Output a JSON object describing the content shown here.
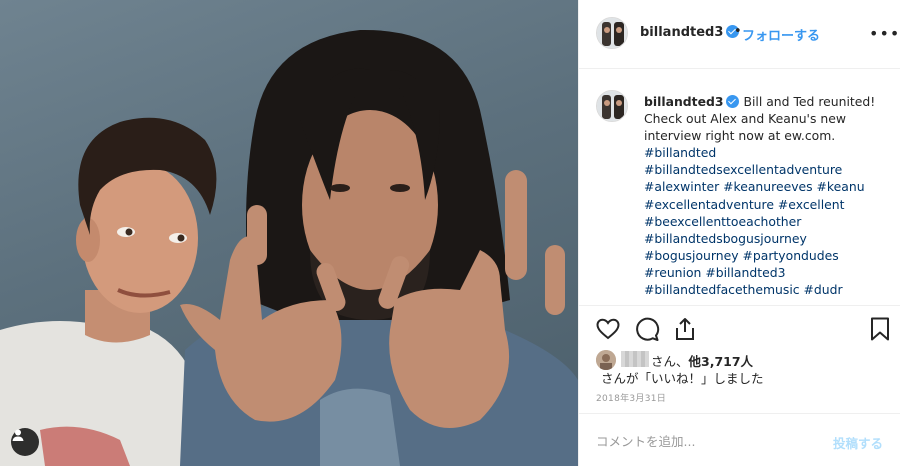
{
  "post": {
    "username": "billandted3",
    "dot": "•",
    "follow_label": "フォローする",
    "more_icon": "more-horizontal-icon",
    "caption_text": "Bill and Ted reunited! Check out Alex and Keanu's new interview right now at ew.com.",
    "hashtags": [
      "#billandted",
      "#billandtedsexcellentadventure",
      "#alexwinter #keanureeves #keanu",
      "#excellentadventure #excellent",
      "#beexcellenttoeachother",
      "#billandtedsbogusjourney",
      "#bogusjourney #partyondudes",
      "#reunion #billandted3",
      "#billandtedfacethemusic #dudr"
    ],
    "likes_line1_suffix": "さん、",
    "likes_count": "他3,717人",
    "likes_line2": "さんが「いいね！」しました",
    "date": "2018年3月31日",
    "comment_placeholder": "コメントを追加...",
    "post_button": "投稿する"
  },
  "colors": {
    "link_blue": "#3897f0",
    "hashtag": "#003569",
    "border": "#efefef",
    "muted": "#999999",
    "post_disabled": "#b2dffc"
  }
}
